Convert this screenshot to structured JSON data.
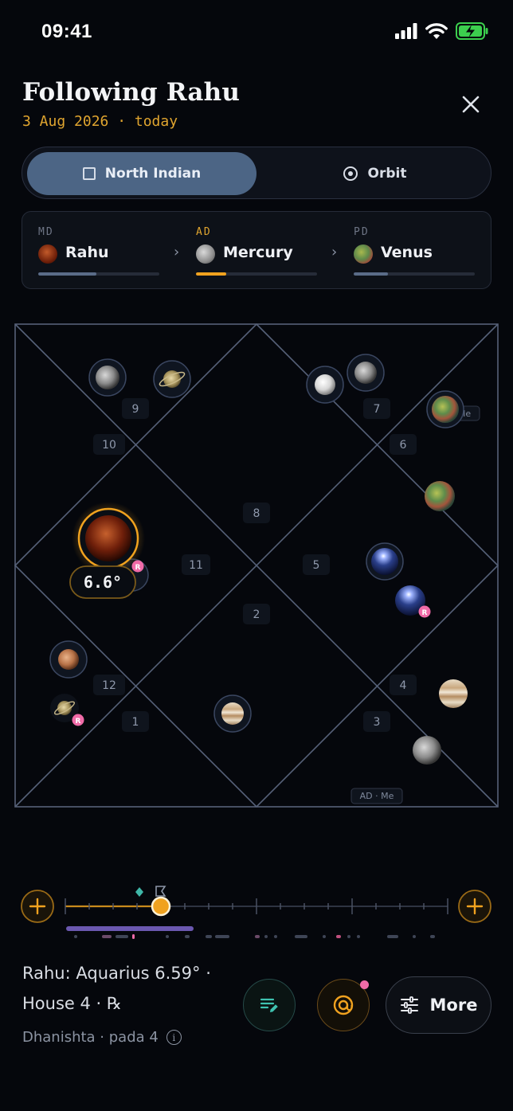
{
  "status": {
    "time": "09:41"
  },
  "header": {
    "title": "Following Rahu",
    "subtitle": "3 Aug 2026 · today"
  },
  "view_toggle": {
    "options": [
      {
        "label": "North Indian",
        "selected": true
      },
      {
        "label": "Orbit",
        "selected": false
      }
    ]
  },
  "dasha": [
    {
      "tag": "MD",
      "planet": "Rahu",
      "progress": 0.48,
      "tag_color": "#6e7585",
      "bar_color": "#5a6c88"
    },
    {
      "tag": "AD",
      "planet": "Mercury",
      "progress": 0.25,
      "tag_color": "#e0a52f",
      "bar_color": "#f0a21f"
    },
    {
      "tag": "PD",
      "planet": "Venus",
      "progress": 0.28,
      "tag_color": "#6e7585",
      "bar_color": "#5a6c88"
    }
  ],
  "chart": {
    "houses": [
      "1",
      "2",
      "3",
      "4",
      "5",
      "6",
      "7",
      "8",
      "9",
      "10",
      "11",
      "12"
    ],
    "focus_degree": "6.6°",
    "retro_mark": "R",
    "tag_me": "Me",
    "tag_ad_me": "AD · Me"
  },
  "info": {
    "line1": "Rahu: Aquarius 6.59° ·",
    "line2": "House 4 · ℞",
    "nakshatra": "Dhanishta · pada 4",
    "info_glyph": "i"
  },
  "buttons": {
    "more": "More"
  },
  "colors": {
    "accent": "#f0a21f",
    "background": "#05070c",
    "grid": "#566178",
    "retro": "#f06ba8"
  }
}
